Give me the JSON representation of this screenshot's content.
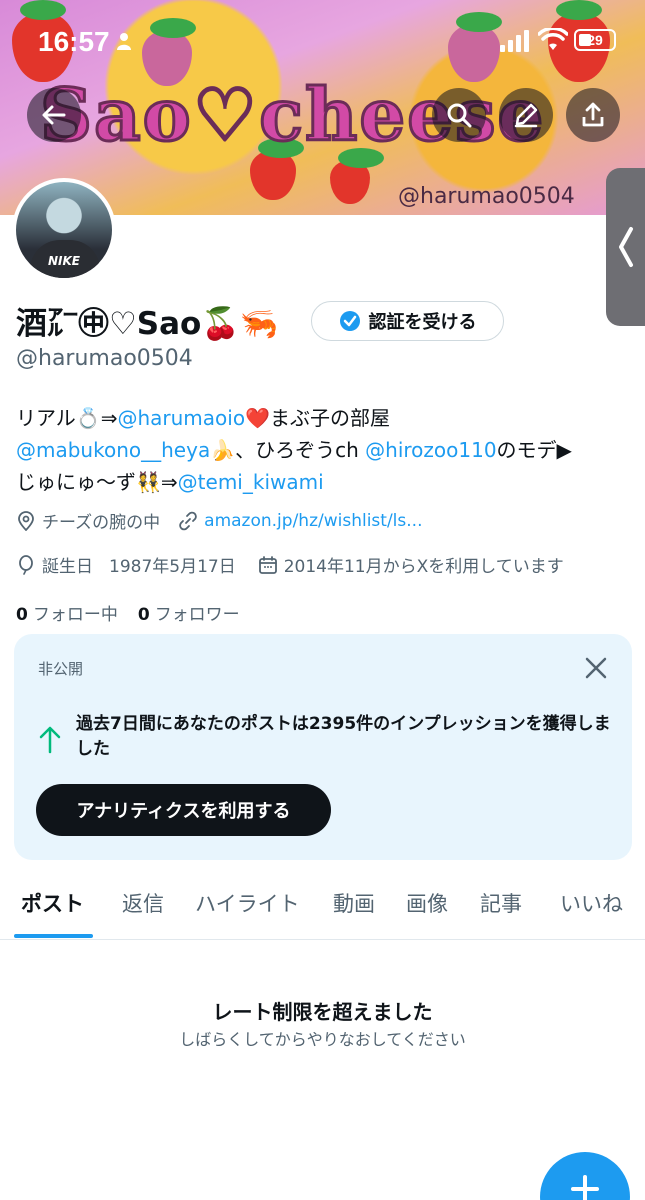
{
  "status_bar": {
    "time": "16:57",
    "battery": "29"
  },
  "banner": {
    "title": "Sao♡cheese",
    "handle_overlay": "@harumao0504"
  },
  "profile": {
    "name": "酒㌃㊥♡Sao🍒🦐",
    "verify_button": "認証を受ける",
    "handle": "@harumao0504",
    "bio": {
      "line1_a": "リアル💍⇒",
      "line1_link": "@harumaoio",
      "line1_b": "❤️まぶ子の部屋",
      "line2_link1": "@mabukono__heya",
      "line2_a": "🍌、ひろぞうch ",
      "line2_link2": "@hirozoo110",
      "line2_b": "のモデ▶",
      "line3_a": "じゅにゅ〜ず👯⇒",
      "line3_link": "@temi_kiwami"
    },
    "location": "チーズの腕の中",
    "website": "amazon.jp/hz/wishlist/ls...",
    "birthday_label": "誕生日",
    "birthday": "1987年5月17日",
    "joined": "2014年11月からXを利用しています",
    "following_count": "0",
    "following_label": "フォロー中",
    "followers_count": "0",
    "followers_label": "フォロワー"
  },
  "analytics_card": {
    "label": "非公開",
    "text": "過去7日間にあなたのポストは2395件のインプレッションを獲得しました",
    "button": "アナリティクスを利用する"
  },
  "tabs": [
    "ポスト",
    "返信",
    "ハイライト",
    "動画",
    "画像",
    "記事",
    "いいね"
  ],
  "empty_state": {
    "title": "レート制限を超えました",
    "subtitle": "しばらくしてからやりなおしてください"
  },
  "colors": {
    "accent": "#1d9bf0",
    "text": "#0f1419",
    "muted": "#536471",
    "card_bg": "#e8f5fd"
  }
}
